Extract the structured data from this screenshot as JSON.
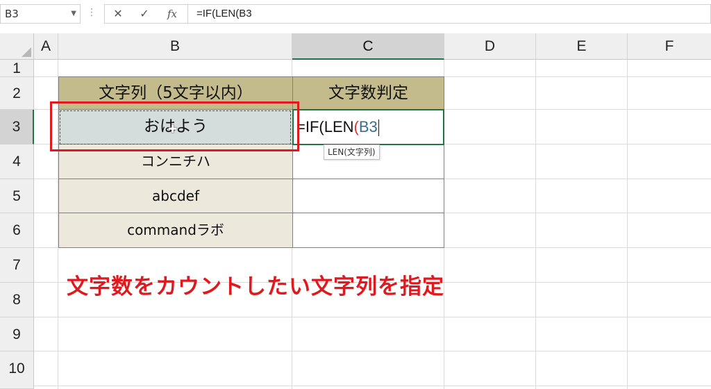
{
  "formula_bar": {
    "name_box": "B3",
    "cancel_icon": "✕",
    "enter_icon": "✓",
    "fx_label": "fx",
    "formula": "=IF(LEN(B3"
  },
  "columns": [
    "A",
    "B",
    "C",
    "D",
    "E",
    "F"
  ],
  "selected_column": "C",
  "rows": [
    "1",
    "2",
    "3",
    "4",
    "5",
    "6",
    "7",
    "8",
    "9",
    "10"
  ],
  "selected_row": "3",
  "table": {
    "header_b": "文字列（5文字以内）",
    "header_c": "文字数判定",
    "strings": [
      "おはよう",
      "コンニチハ",
      "abcdef",
      "commandラボ"
    ]
  },
  "editing_cell": {
    "prefix": "=IF(LEN",
    "paren": "(",
    "ref": "B3"
  },
  "tooltip": "LEN(文字列)",
  "annotation": "文字数をカウントしたい文字列を指定",
  "colors": {
    "header_fill": "#c4bb8c",
    "data_fill": "#ede8dc",
    "selection_green": "#1f7346",
    "annotation_red": "#e0191f"
  },
  "icons": [
    "cancel-icon",
    "enter-icon",
    "fx-icon",
    "dropdown-arrow-icon",
    "select-all-triangle-icon",
    "cross-cursor-icon"
  ]
}
